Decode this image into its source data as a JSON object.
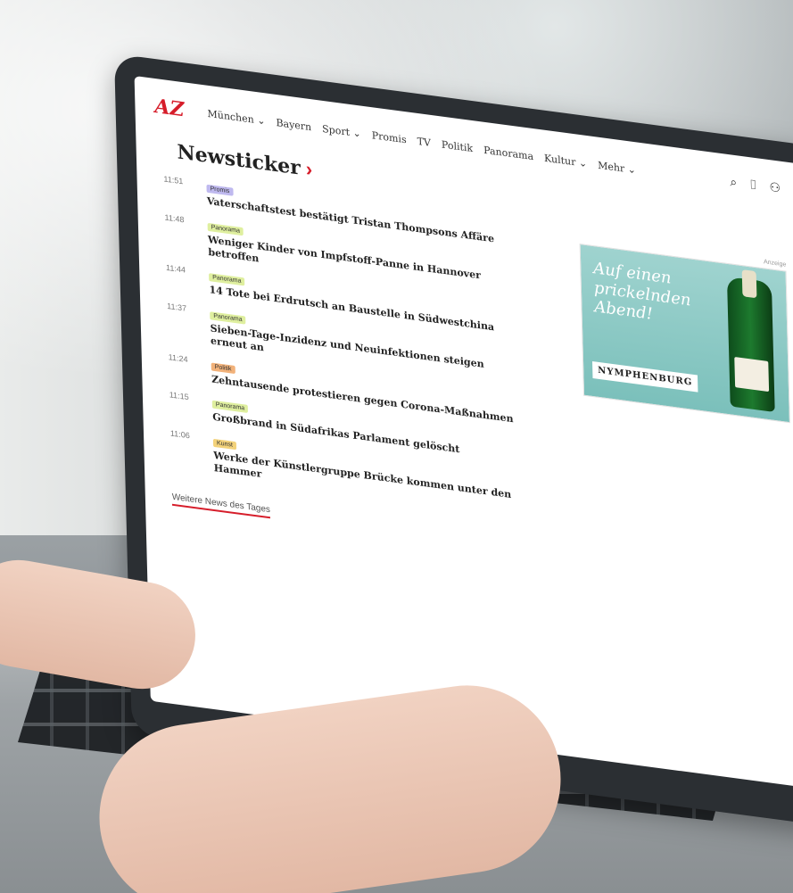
{
  "colors": {
    "accent": "#d61d2a",
    "badge_promi": "#bfb9ef",
    "badge_panorama": "#dfef9f",
    "badge_politik": "#f2b27a",
    "badge_kunst": "#f3d27a"
  },
  "site": {
    "logo": "AZ",
    "nav": [
      "München ⌄",
      "Bayern",
      "Sport ⌄",
      "Promis",
      "TV",
      "Politik",
      "Panorama",
      "Kultur ⌄",
      "Mehr ⌄"
    ],
    "icons": [
      "search-icon",
      "bookmark-icon",
      "user-icon"
    ]
  },
  "newsticker": {
    "title": "Newsticker",
    "items": [
      {
        "time": "11:51",
        "category": "Promis",
        "headline": "Vaterschaftstest bestätigt Tristan Thompsons Affäre"
      },
      {
        "time": "11:48",
        "category": "Panorama",
        "headline": "Weniger Kinder von Impfstoff-Panne in Hannover betroffen"
      },
      {
        "time": "11:44",
        "category": "Panorama",
        "headline": "14 Tote bei Erdrutsch an Baustelle in Südwestchina"
      },
      {
        "time": "11:37",
        "category": "Panorama",
        "headline": "Sieben-Tage-Inzidenz und Neuinfektionen steigen erneut an"
      },
      {
        "time": "11:24",
        "category": "Politik",
        "headline": "Zehntausende protestieren gegen Corona-Maßnahmen"
      },
      {
        "time": "11:15",
        "category": "Panorama",
        "headline": "Großbrand in Südafrikas Parlament gelöscht"
      },
      {
        "time": "11:06",
        "category": "Kunst",
        "headline": "Werke der Künstlergruppe Brücke kommen unter den Hammer"
      }
    ],
    "more_link": "Weitere News des Tages"
  },
  "ad": {
    "label": "Anzeige",
    "text": "Auf einen prickelnden Abend!",
    "brand": "NYMPHENBURG"
  }
}
